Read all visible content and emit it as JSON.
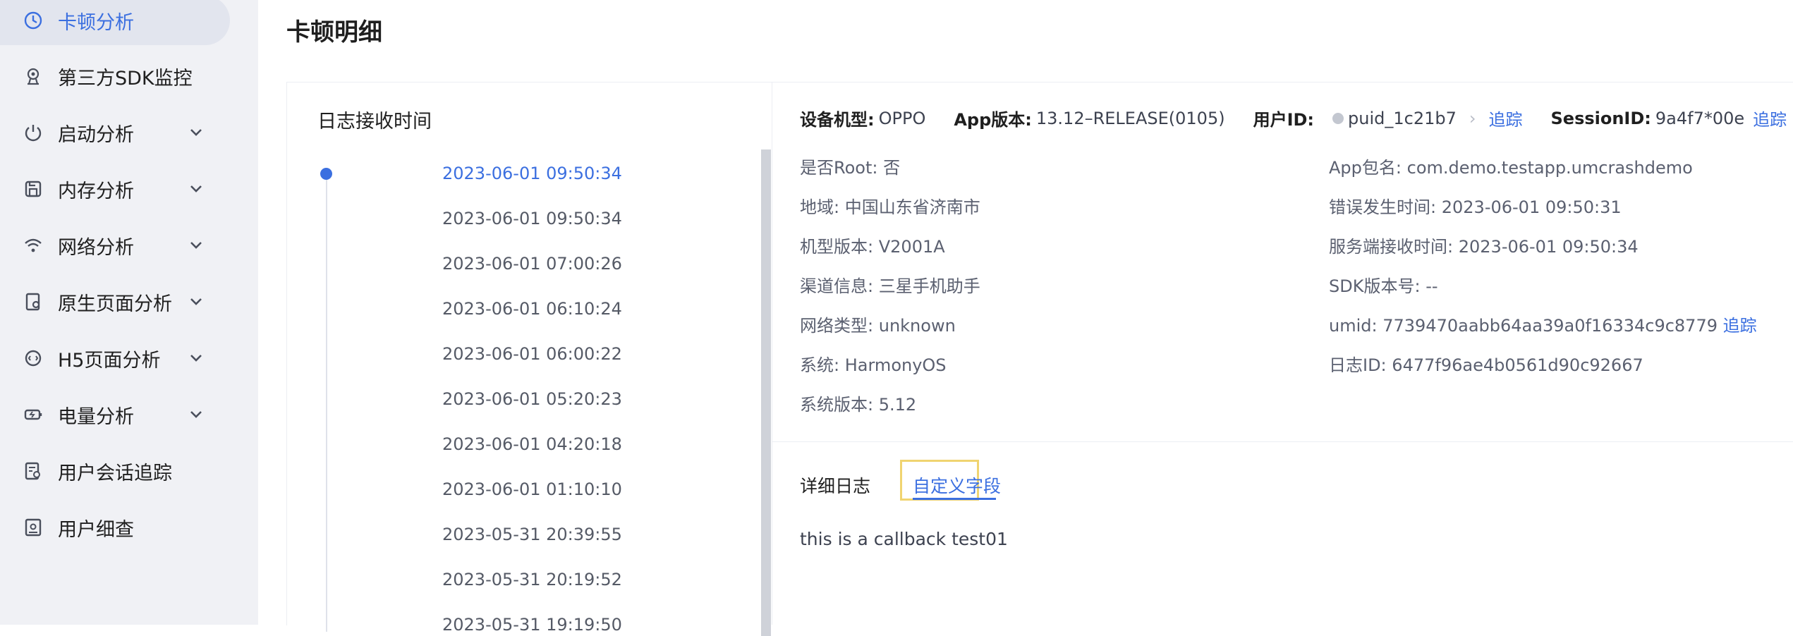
{
  "sidebar": {
    "items": [
      {
        "label": "卡顿分析",
        "icon": "stutter-analysis-icon",
        "active": true,
        "expandable": false
      },
      {
        "label": "第三方SDK监控",
        "icon": "sdk-monitor-icon",
        "active": false,
        "expandable": false
      },
      {
        "label": "启动分析",
        "icon": "power-icon",
        "active": false,
        "expandable": true
      },
      {
        "label": "内存分析",
        "icon": "save-icon",
        "active": false,
        "expandable": true
      },
      {
        "label": "网络分析",
        "icon": "wifi-icon",
        "active": false,
        "expandable": true
      },
      {
        "label": "原生页面分析",
        "icon": "page-icon",
        "active": false,
        "expandable": true
      },
      {
        "label": "H5页面分析",
        "icon": "h5-icon",
        "active": false,
        "expandable": true
      },
      {
        "label": "电量分析",
        "icon": "battery-icon",
        "active": false,
        "expandable": true
      },
      {
        "label": "用户会话追踪",
        "icon": "session-trace-icon",
        "active": false,
        "expandable": false
      },
      {
        "label": "用户细查",
        "icon": "user-detail-icon",
        "active": false,
        "expandable": false
      }
    ]
  },
  "page": {
    "title": "卡顿明细"
  },
  "log_panel": {
    "title": "日志接收时间",
    "timestamps": [
      "2023-06-01 09:50:34",
      "2023-06-01 09:50:34",
      "2023-06-01 07:00:26",
      "2023-06-01 06:10:24",
      "2023-06-01 06:00:22",
      "2023-06-01 05:20:23",
      "2023-06-01 04:20:18",
      "2023-06-01 01:10:10",
      "2023-05-31 20:39:55",
      "2023-05-31 20:19:52",
      "2023-05-31 19:19:50"
    ],
    "active_index": 0
  },
  "detail": {
    "device_model_label": "设备机型:",
    "device_model": "OPPO",
    "app_version_label": "App版本:",
    "app_version": "13.12–RELEASE(0105)",
    "user_id_label": "用户ID:",
    "user_id": "puid_1c21b7",
    "trace_label": "追踪",
    "session_id_label": "SessionID:",
    "session_id": "9a4f7*00e",
    "session_trace_label": "追踪",
    "left_fields": [
      {
        "key": "是否Root:",
        "value": "否"
      },
      {
        "key": "地域:",
        "value": "中国山东省济南市"
      },
      {
        "key": "机型版本:",
        "value": "V2001A"
      },
      {
        "key": "渠道信息:",
        "value": "三星手机助手"
      },
      {
        "key": "网络类型:",
        "value": "unknown"
      },
      {
        "key": "系统:",
        "value": "HarmonyOS"
      },
      {
        "key": "系统版本:",
        "value": "5.12"
      }
    ],
    "right_fields": [
      {
        "key": "App包名:",
        "value": "com.demo.testapp.umcrashdemo"
      },
      {
        "key": "错误发生时间:",
        "value": "2023-06-01 09:50:31"
      },
      {
        "key": "服务端接收时间:",
        "value": "2023-06-01 09:50:34"
      },
      {
        "key": "SDK版本号:",
        "value": "--"
      },
      {
        "key": "umid:",
        "value": "7739470aabb64aa39a0f16334c9c8779"
      },
      {
        "key": "日志ID:",
        "value": "6477f96ae4b0561d90c92667"
      }
    ],
    "umid_trace_label": "追踪",
    "tabs": [
      "详细日志",
      "自定义字段"
    ],
    "active_tab": 1,
    "custom_content": "this is a callback test01"
  },
  "colors": {
    "accent": "#3b6fe0",
    "sidebar_bg": "#f0f1f5",
    "highlight_box": "#f0d470"
  }
}
